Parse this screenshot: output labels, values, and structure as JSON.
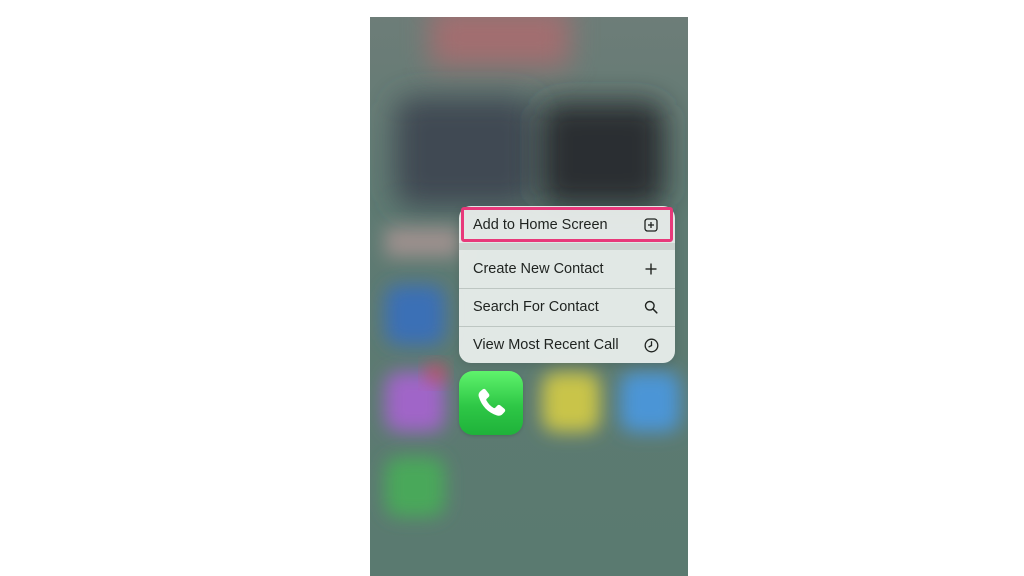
{
  "context_menu": {
    "items": [
      {
        "label": "Add to Home Screen",
        "icon": "add-square-icon"
      },
      {
        "label": "Create New Contact",
        "icon": "plus-icon"
      },
      {
        "label": "Search For Contact",
        "icon": "search-icon"
      },
      {
        "label": "View Most Recent Call",
        "icon": "clock-icon"
      }
    ]
  },
  "highlight_color": "#e8397a",
  "app": {
    "name": "Phone",
    "icon": "phone-handset-icon",
    "color": "#2ec746"
  }
}
